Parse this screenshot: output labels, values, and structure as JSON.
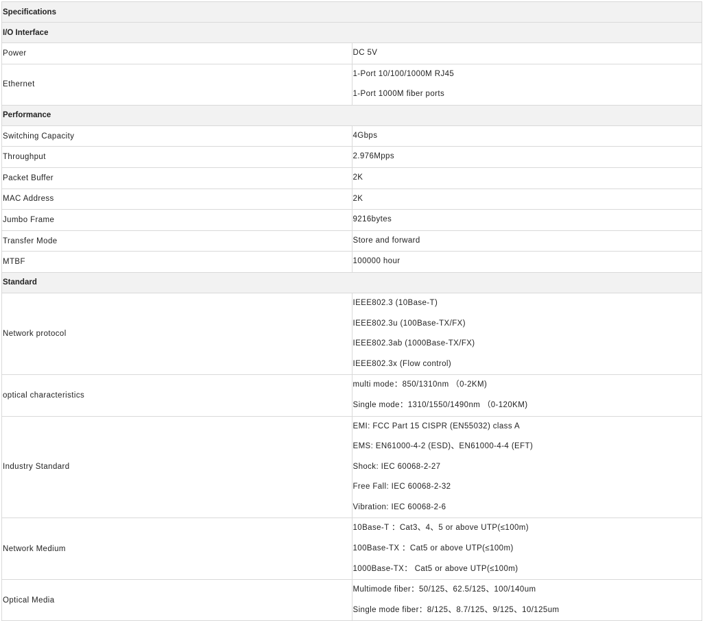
{
  "title": "Specifications",
  "sections": [
    {
      "heading": "I/O Interface",
      "rows": [
        {
          "label": "Power",
          "values": [
            "DC 5V"
          ]
        },
        {
          "label": "Ethernet",
          "values": [
            "1-Port 10/100/1000M RJ45",
            "1-Port 1000M fiber ports"
          ]
        }
      ]
    },
    {
      "heading": "Performance",
      "rows": [
        {
          "label": "Switching Capacity",
          "values": [
            "4Gbps"
          ]
        },
        {
          "label": "Throughput",
          "values": [
            "2.976Mpps"
          ]
        },
        {
          "label": "Packet Buffer",
          "values": [
            "2K"
          ]
        },
        {
          "label": "MAC Address",
          "values": [
            "2K"
          ]
        },
        {
          "label": "Jumbo Frame",
          "values": [
            "9216bytes"
          ]
        },
        {
          "label": "Transfer Mode",
          "values": [
            "Store and forward"
          ]
        },
        {
          "label": "MTBF",
          "values": [
            "100000 hour"
          ]
        }
      ]
    },
    {
      "heading": "Standard",
      "rows": [
        {
          "label": "Network protocol",
          "values": [
            "IEEE802.3 (10Base-T)",
            "IEEE802.3u (100Base-TX/FX)",
            "IEEE802.3ab (1000Base-TX/FX)",
            "IEEE802.3x (Flow control)"
          ]
        },
        {
          "label": "optical characteristics",
          "values": [
            "multi mode：850/1310nm （0-2KM)",
            "Single mode：1310/1550/1490nm （0-120KM)"
          ]
        },
        {
          "label": "Industry Standard",
          "values": [
            "EMI: FCC Part 15 CISPR (EN55032) class A",
            "EMS: EN61000-4-2 (ESD)、EN61000-4-4 (EFT)",
            "Shock: IEC 60068-2-27",
            "Free Fall: IEC 60068-2-32",
            "Vibration: IEC 60068-2-6"
          ]
        },
        {
          "label": "Network Medium",
          "values": [
            "10Base-T ：Cat3、4、5 or above UTP(≤100m)",
            "100Base-TX ：Cat5 or above UTP(≤100m)",
            "1000Base-TX： Cat5 or above UTP(≤100m)"
          ]
        },
        {
          "label": "Optical Media",
          "values": [
            "Multimode fiber：50/125、62.5/125、100/140um",
            "Single mode fiber：8/125、8.7/125、9/125、10/125um"
          ]
        }
      ]
    }
  ]
}
